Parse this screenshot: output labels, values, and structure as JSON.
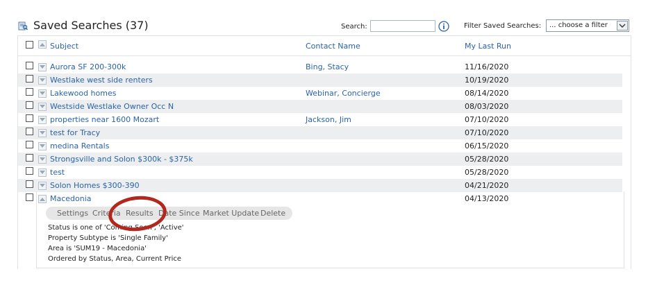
{
  "header": {
    "title": "Saved Searches (37)",
    "search_label": "Search:",
    "search_value": "",
    "filter_label": "Filter Saved Searches:",
    "filter_selected": "... choose a filter"
  },
  "columns": {
    "subject": "Subject",
    "contact": "Contact Name",
    "last_run": "My Last Run"
  },
  "rows": [
    {
      "subject": "Aurora SF 200-300k",
      "contact": "Bing, Stacy",
      "last_run": "11/16/2020"
    },
    {
      "subject": "Westlake west side renters",
      "contact": "",
      "last_run": "10/19/2020"
    },
    {
      "subject": "Lakewood homes",
      "contact": "Webinar, Concierge",
      "last_run": "08/14/2020"
    },
    {
      "subject": "Westside Westlake Owner Occ N",
      "contact": "",
      "last_run": "08/03/2020"
    },
    {
      "subject": "properties near 1600 Mozart",
      "contact": "Jackson, Jim",
      "last_run": "07/10/2020"
    },
    {
      "subject": "test for Tracy",
      "contact": "",
      "last_run": "07/10/2020"
    },
    {
      "subject": "medina Rentals",
      "contact": "",
      "last_run": "06/15/2020"
    },
    {
      "subject": "Strongsville and Solon $300k - $375k",
      "contact": "",
      "last_run": "05/28/2020"
    },
    {
      "subject": "test",
      "contact": "",
      "last_run": "05/28/2020"
    },
    {
      "subject": "Solon Homes $300-390",
      "contact": "",
      "last_run": "04/21/2020"
    },
    {
      "subject": "Macedonia",
      "contact": "",
      "last_run": "04/13/2020"
    }
  ],
  "expanded": {
    "actions": [
      "Settings",
      "Criteria",
      "Results",
      "Date Since",
      "Market Update",
      "Delete"
    ],
    "criteria": [
      "Status is one of 'Coming Soon', 'Active'",
      "Property Subtype is 'Single Family'",
      "Area is 'SUM19 - Macedonia'",
      "Ordered by Status, Area, Current Price"
    ]
  },
  "icons": {
    "title": "saved-search-icon",
    "info": "info-icon",
    "toggle_down": "chevron-down-icon",
    "toggle_up": "chevron-up-icon"
  },
  "colors": {
    "link": "#2a63a8",
    "stripe": "#eceef0",
    "highlight_circle": "#b1281e",
    "action_bar": "#e6e6e6"
  }
}
